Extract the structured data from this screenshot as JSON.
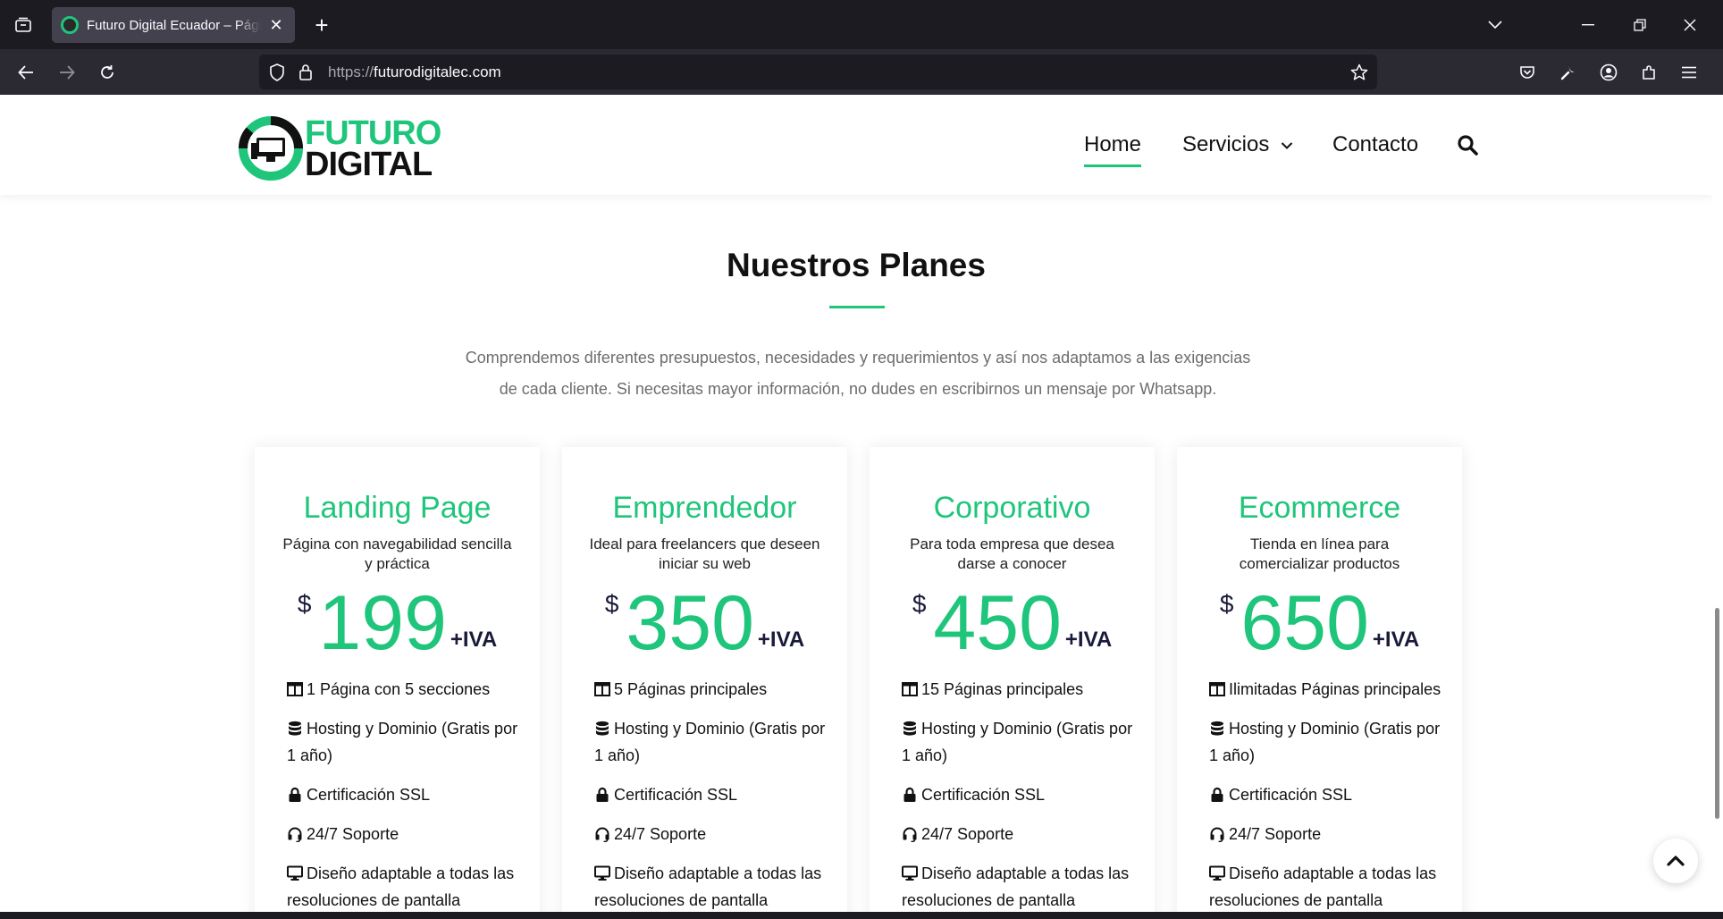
{
  "browser": {
    "tab": {
      "title": "Futuro Digital Ecuador – Página"
    },
    "url": {
      "scheme": "https://",
      "host": "futurodigitalec.com"
    }
  },
  "site": {
    "logo": {
      "line1": "FUTURO",
      "line2": "DIGITAL"
    },
    "menu": [
      {
        "label": "Home",
        "active": true
      },
      {
        "label": "Servicios",
        "has_dropdown": true
      },
      {
        "label": "Contacto"
      }
    ]
  },
  "section": {
    "title": "Nuestros Planes",
    "description": "Comprendemos diferentes presupuestos, necesidades y requerimientos y así nos adaptamos a las exigencias de cada cliente. Si necesitas mayor información, no dudes en escribirnos un mensaje por Whatsapp."
  },
  "plans": [
    {
      "name": "Landing Page",
      "description": "Página con navegabilidad sencilla y práctica",
      "currency": "$",
      "price": "199",
      "suffix": "+IVA",
      "features": [
        {
          "icon": "columns-icon",
          "text": "1 Página con 5 secciones"
        },
        {
          "icon": "database-icon",
          "text": "Hosting y Dominio (Gratis por 1 año)"
        },
        {
          "icon": "lock-icon",
          "text": "Certificación SSL"
        },
        {
          "icon": "headset-icon",
          "text": "24/7 Soporte"
        },
        {
          "icon": "desktop-icon",
          "text": "Diseño adaptable a todas las resoluciones de pantalla"
        }
      ]
    },
    {
      "name": "Emprendedor",
      "description": "Ideal para freelancers que deseen iniciar su web",
      "currency": "$",
      "price": "350",
      "suffix": "+IVA",
      "features": [
        {
          "icon": "columns-icon",
          "text": "5 Páginas principales"
        },
        {
          "icon": "database-icon",
          "text": "Hosting y Dominio (Gratis por 1 año)"
        },
        {
          "icon": "lock-icon",
          "text": "Certificación SSL"
        },
        {
          "icon": "headset-icon",
          "text": "24/7 Soporte"
        },
        {
          "icon": "desktop-icon",
          "text": "Diseño adaptable a todas las resoluciones de pantalla"
        }
      ]
    },
    {
      "name": "Corporativo",
      "description": "Para toda empresa que desea darse a conocer",
      "currency": "$",
      "price": "450",
      "suffix": "+IVA",
      "features": [
        {
          "icon": "columns-icon",
          "text": "15 Páginas principales"
        },
        {
          "icon": "database-icon",
          "text": "Hosting y Dominio (Gratis por 1 año)"
        },
        {
          "icon": "lock-icon",
          "text": "Certificación SSL"
        },
        {
          "icon": "headset-icon",
          "text": "24/7 Soporte"
        },
        {
          "icon": "desktop-icon",
          "text": "Diseño adaptable a todas las resoluciones de pantalla"
        }
      ]
    },
    {
      "name": "Ecommerce",
      "description": "Tienda en línea para comercializar productos",
      "currency": "$",
      "price": "650",
      "suffix": "+IVA",
      "features": [
        {
          "icon": "columns-icon",
          "text": "Ilimitadas Páginas principales"
        },
        {
          "icon": "database-icon",
          "text": "Hosting y Dominio (Gratis por 1 año)"
        },
        {
          "icon": "lock-icon",
          "text": "Certificación SSL"
        },
        {
          "icon": "headset-icon",
          "text": "24/7 Soporte"
        },
        {
          "icon": "desktop-icon",
          "text": "Diseño adaptable a todas las resoluciones de pantalla"
        }
      ]
    }
  ],
  "colors": {
    "accent": "#1fc57b",
    "dark": "#111111",
    "price_dark": "#1a1a3a"
  }
}
